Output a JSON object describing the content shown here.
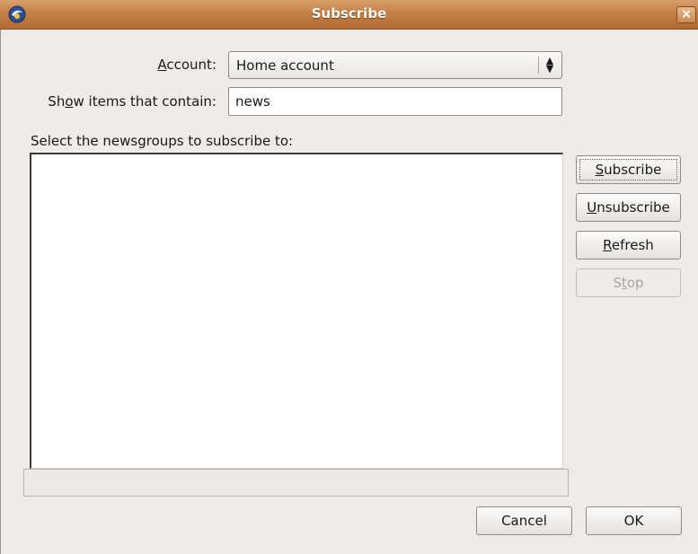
{
  "window": {
    "title": "Subscribe",
    "close_glyph": "×",
    "app_icon": "thunderbird-icon"
  },
  "form": {
    "account_label": {
      "prefix": "",
      "mnemonic": "A",
      "rest": "ccount:"
    },
    "account_value": "Home account",
    "filter_label": {
      "prefix": "Sh",
      "mnemonic": "o",
      "rest": "w items that contain:"
    },
    "filter_value": "news",
    "list_label": "Select the newsgroups to subscribe to:"
  },
  "side_buttons": [
    {
      "mnemonic": "S",
      "rest": "ubscribe",
      "prefix": "",
      "state": "focused"
    },
    {
      "mnemonic": "U",
      "rest": "nsubscribe",
      "prefix": "",
      "state": "normal"
    },
    {
      "mnemonic": "R",
      "rest": "efresh",
      "prefix": "",
      "state": "normal"
    },
    {
      "mnemonic": "t",
      "rest": "op",
      "prefix": "S",
      "state": "disabled"
    }
  ],
  "footer": {
    "cancel_label": "Cancel",
    "ok_label": "OK"
  },
  "colors": {
    "titlebar": "#c58046",
    "background": "#efebe7"
  }
}
